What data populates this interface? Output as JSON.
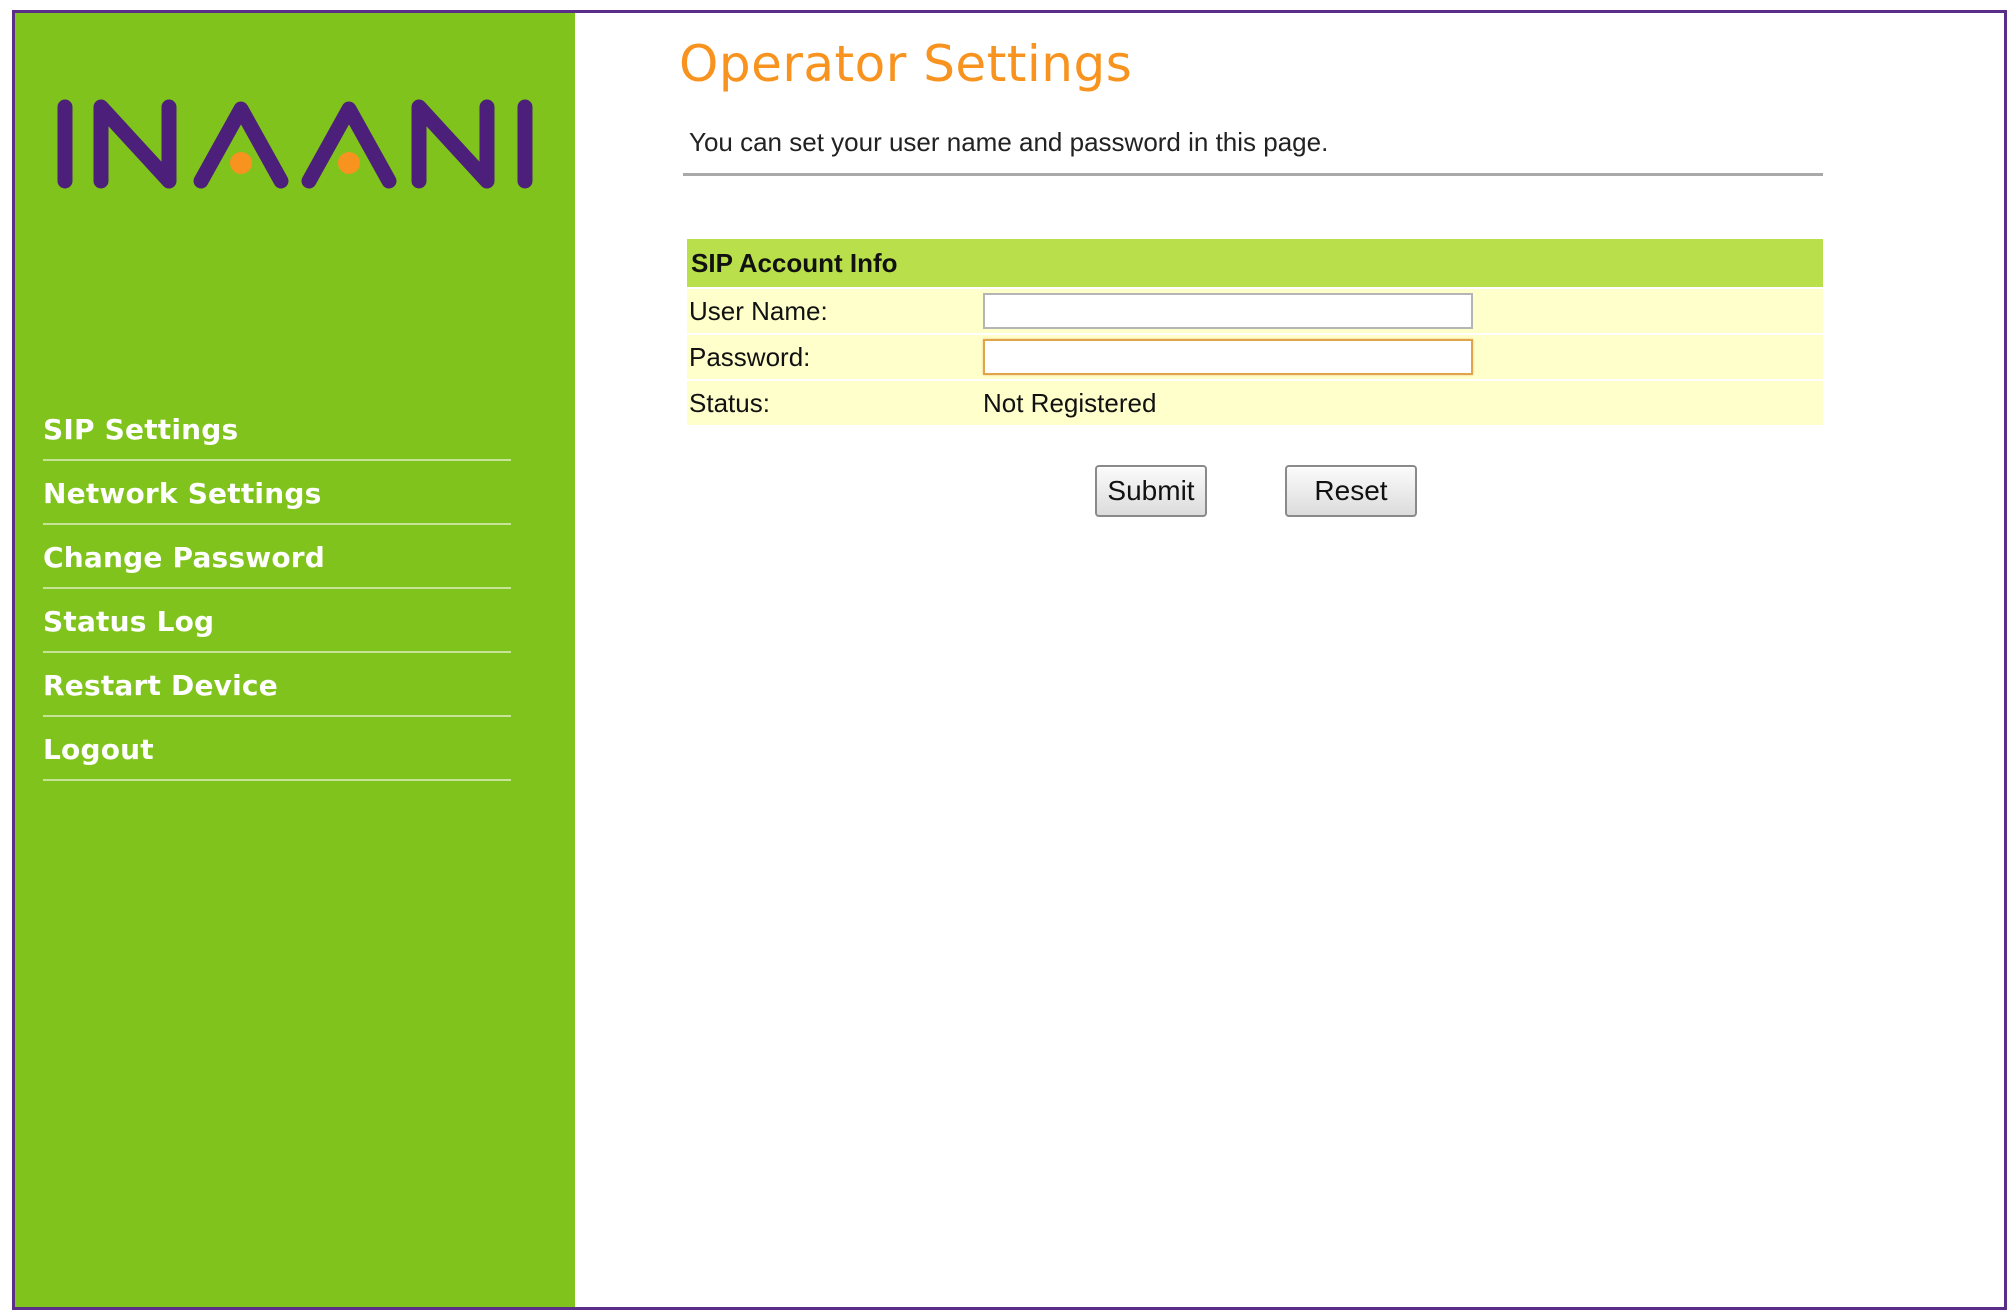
{
  "brand": {
    "logo_text": "INAANI",
    "colors": {
      "sidebar": "#80c31c",
      "logo_purple": "#4b1f7a",
      "logo_accent": "#f7931e",
      "frame_border": "#5a2d88",
      "title": "#f7931e",
      "section_header": "#b9e04a",
      "row_background": "#ffffcc"
    }
  },
  "sidebar": {
    "items": [
      {
        "label": "SIP Settings"
      },
      {
        "label": "Network Settings"
      },
      {
        "label": "Change Password"
      },
      {
        "label": "Status Log"
      },
      {
        "label": "Restart Device"
      },
      {
        "label": "Logout"
      }
    ]
  },
  "main": {
    "title": "Operator Settings",
    "description": "You can set your user name and password in this page.",
    "section": {
      "header": "SIP Account Info",
      "username_label": "User Name:",
      "username_value": "",
      "password_label": "Password:",
      "password_value": "",
      "status_label": "Status:",
      "status_value": "Not Registered"
    },
    "buttons": {
      "submit": "Submit",
      "reset": "Reset"
    }
  }
}
